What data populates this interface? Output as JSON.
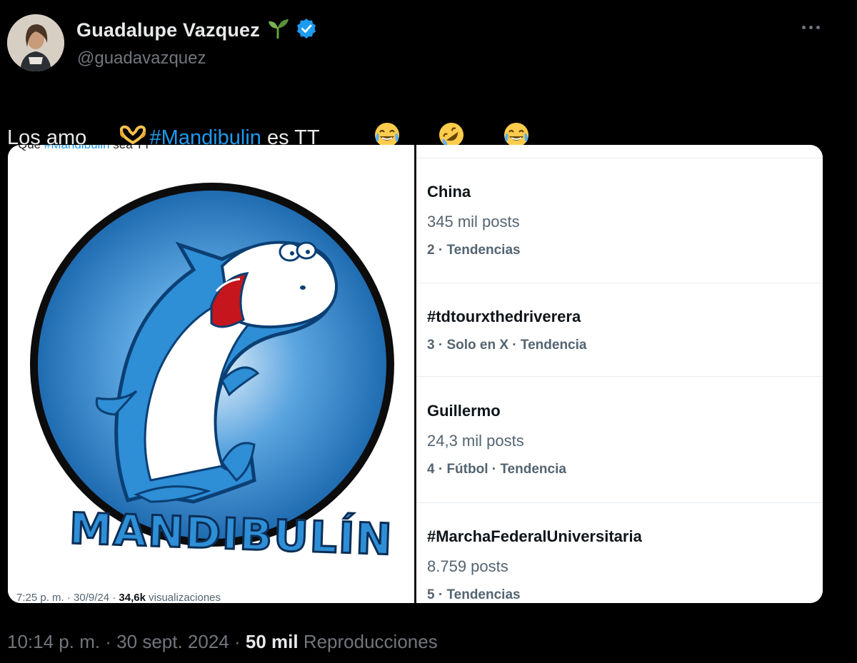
{
  "author": {
    "name": "Guadalupe Vazquez",
    "handle": "@guadavazquez",
    "name_emoji_icon": "seedling-icon",
    "verified_icon": "verified-badge-icon"
  },
  "tweet": {
    "text_prefix": "Los amo ",
    "heart_hands_icon": "heart-hands-icon",
    "hashtag": "#Mandibulin",
    "text_suffix": " es TT",
    "emojis": [
      "joy-icon",
      "rofl-icon",
      "joy-icon"
    ]
  },
  "media": {
    "left": {
      "caption_prefix": "Que ",
      "caption_hashtag": "#Mandibulin",
      "caption_suffix": " sea TT",
      "logo_text": "MANDIBULÍN",
      "meta_time": "7:25 p. m. · 30/9/24 · ",
      "meta_views": "34,6k",
      "meta_label": " visualizaciones"
    },
    "trends": [
      {
        "title": "China",
        "posts": "345 mil posts",
        "meta": "2 · Tendencias"
      },
      {
        "title": "#tdtourxthedriverera",
        "posts": "",
        "meta": "3 · Solo en X · Tendencia"
      },
      {
        "title": "Guillermo",
        "posts": "24,3 mil posts",
        "meta": "4 · Fútbol · Tendencia"
      },
      {
        "title": "#MarchaFederalUniversitaria",
        "posts": "8.759 posts",
        "meta": "5 · Tendencias"
      }
    ]
  },
  "footer": {
    "time": "10:14 p. m. · 30 sept. 2024 · ",
    "views": "50 mil",
    "views_label": " Reproducciones"
  },
  "colors": {
    "background": "#000000",
    "hashtag": "#1d9bf0",
    "verified": "#1d9bf0",
    "secondary_text": "#71767b"
  }
}
